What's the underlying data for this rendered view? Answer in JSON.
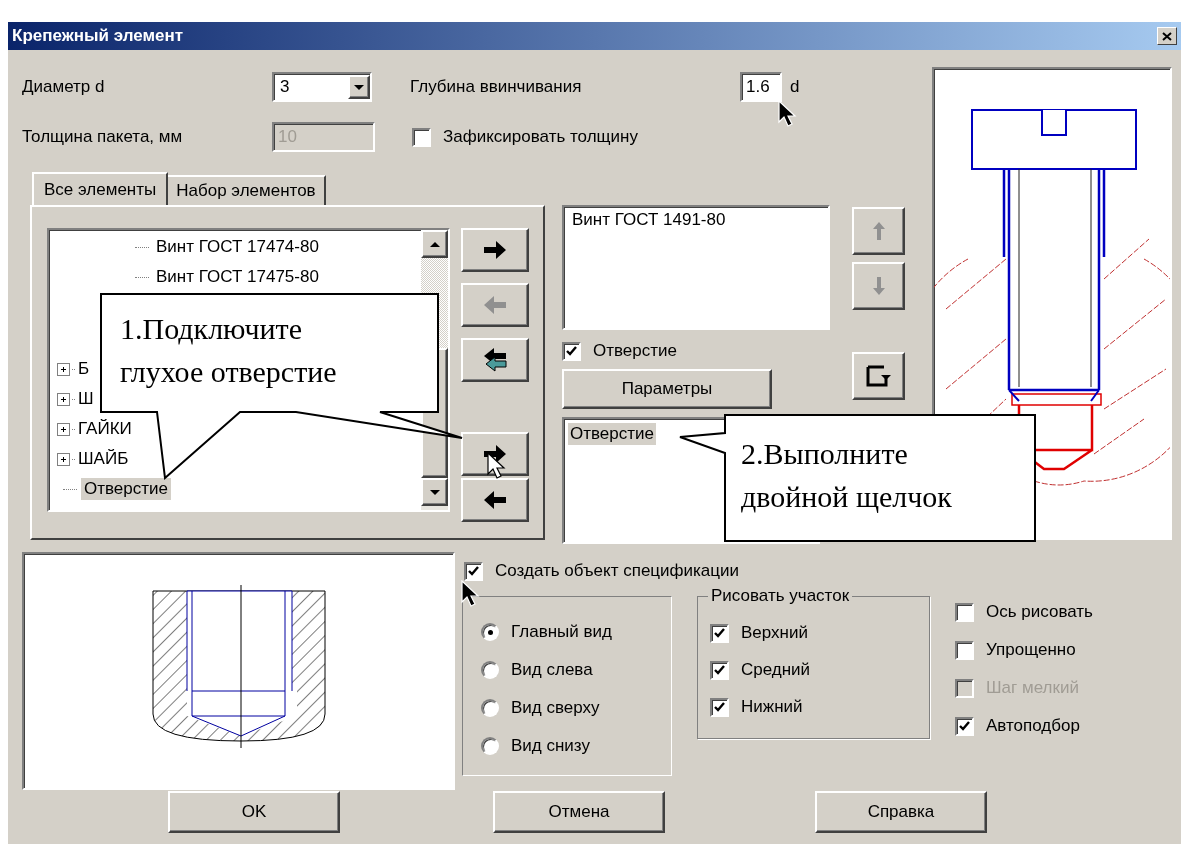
{
  "window": {
    "title": "Крепежный элемент"
  },
  "diameter": {
    "label": "Диаметр d",
    "value": "3"
  },
  "depth": {
    "label": "Глубина ввинчивания",
    "value": "1.6",
    "unit": "d"
  },
  "thickness": {
    "label": "Толщина пакета, мм",
    "value": "10",
    "disabled": true
  },
  "fix_thickness": {
    "label": "Зафиксировать толщину",
    "checked": false
  },
  "tabs": [
    {
      "label": "Все элементы",
      "selected": true
    },
    {
      "label": "Набор элементов",
      "selected": false
    }
  ],
  "tree": {
    "items": [
      {
        "children": [
          {
            "children": [
              {
                "label": "Винт ГОСТ 17474-80",
                "selected": false
              },
              {
                "label": "Винт ГОСТ 17475-80",
                "selected": false
              }
            ]
          }
        ]
      },
      {
        "label": "Б",
        "expanded": false,
        "selected": false
      },
      {
        "label": "Ш",
        "expanded": false,
        "selected": false
      },
      {
        "label": "ГАЙКИ",
        "expanded": false,
        "selected": false
      },
      {
        "label": "ШАЙБ",
        "expanded": false,
        "selected": false
      },
      {
        "label": "Отверстие",
        "selected": true
      }
    ]
  },
  "transfer_buttons": [
    {
      "kind": "add",
      "disabled": false
    },
    {
      "kind": "remove",
      "disabled": true
    },
    {
      "kind": "remove_all",
      "disabled": false
    },
    {
      "kind": "add",
      "disabled": false
    },
    {
      "kind": "remove",
      "disabled": false
    }
  ],
  "set_list": {
    "items": [
      {
        "label": "Винт ГОСТ 1491-80",
        "selected": false
      }
    ]
  },
  "order_buttons": [
    {
      "kind": "up",
      "disabled": true
    },
    {
      "kind": "down",
      "disabled": true
    },
    {
      "kind": "reset",
      "disabled": false
    }
  ],
  "hole_check": {
    "label": "Отверстие",
    "checked": true
  },
  "params_button": "Параметры",
  "hole_list": {
    "items": [
      {
        "label": "Отверстие",
        "selected": true
      }
    ]
  },
  "callouts": [
    {
      "text": "1.Подключите глухое отверстие"
    },
    {
      "text": "2.Выполните двойной щелчок"
    }
  ],
  "spec_check": {
    "label": "Создать объект спецификации",
    "checked": true
  },
  "views": [
    {
      "label": "Главный вид",
      "selected": true
    },
    {
      "label": "Вид слева",
      "selected": false
    },
    {
      "label": "Вид сверху",
      "selected": false
    },
    {
      "label": "Вид снизу",
      "selected": false
    }
  ],
  "draw_section": {
    "title": "Рисовать участок",
    "items": [
      {
        "label": "Верхний",
        "checked": true
      },
      {
        "label": "Средний",
        "checked": true
      },
      {
        "label": "Нижний",
        "checked": true
      }
    ]
  },
  "options": [
    {
      "label": "Ось рисовать",
      "checked": false,
      "disabled": false
    },
    {
      "label": "Упрощенно",
      "checked": false,
      "disabled": false
    },
    {
      "label": "Шаг мелкий",
      "checked": false,
      "disabled": true
    },
    {
      "label": "Автоподбор",
      "checked": true,
      "disabled": false
    }
  ],
  "buttons": [
    "OK",
    "Отмена",
    "Справка"
  ]
}
